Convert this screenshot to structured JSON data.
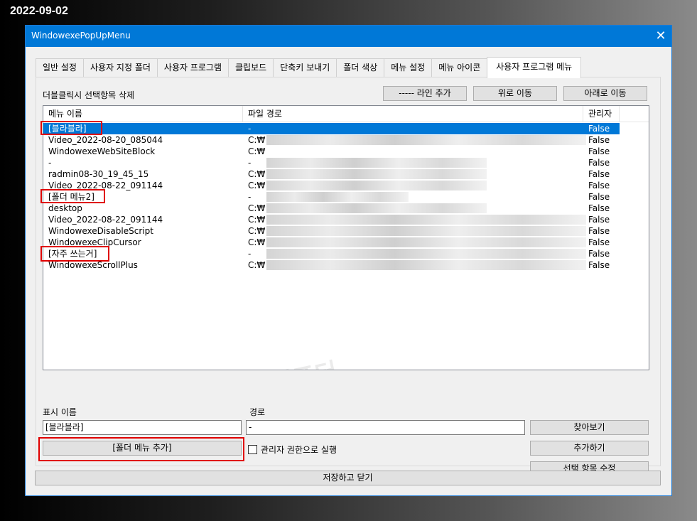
{
  "date_stamp": "2022-09-02",
  "window": {
    "title": "WindowexePopUpMenu",
    "close_glyph": "✕"
  },
  "tabs": [
    {
      "label": "일반 설정"
    },
    {
      "label": "사용자 지정 폴더"
    },
    {
      "label": "사용자 프로그램"
    },
    {
      "label": "클립보드"
    },
    {
      "label": "단축키 보내기"
    },
    {
      "label": "폴더 색상"
    },
    {
      "label": "메뉴 설정"
    },
    {
      "label": "메뉴 아이콘"
    },
    {
      "label": "사용자 프로그램 메뉴",
      "active": true
    }
  ],
  "toolbar": {
    "hint": "더블클릭시 선택항목 삭제",
    "add_line": "----- 라인 추가",
    "move_up": "위로 이동",
    "move_down": "아래로 이동"
  },
  "list": {
    "columns": [
      "메뉴 이름",
      "파일 경로",
      "관리자"
    ],
    "rows": [
      {
        "name": "[블라블라]",
        "path": "-",
        "admin": "False",
        "selected": true
      },
      {
        "name": "Video_2022-08-20_085044",
        "path": "C:₩",
        "admin": "False"
      },
      {
        "name": "WindowexeWebSiteBlock",
        "path": "C:₩",
        "admin": "False"
      },
      {
        "name": "-",
        "path": "-",
        "admin": "False"
      },
      {
        "name": "radmin08-30_19_45_15",
        "path": "C:₩",
        "admin": "False"
      },
      {
        "name": "Video_2022-08-22_091144",
        "path": "C:₩",
        "admin": "False"
      },
      {
        "name": "[폴더 메뉴2]",
        "path": "-",
        "admin": "False"
      },
      {
        "name": "desktop",
        "path": "C:₩",
        "admin": "False"
      },
      {
        "name": "Video_2022-08-22_091144",
        "path": "C:₩",
        "admin": "False"
      },
      {
        "name": "WindowexeDisableScript",
        "path": "C:₩",
        "admin": "False"
      },
      {
        "name": "WindowexeClipCursor",
        "path": "C:₩",
        "admin": "False"
      },
      {
        "name": "[자주 쓰는거]",
        "path": "-",
        "admin": "False"
      },
      {
        "name": "WindowexeScrollPlus",
        "path": "C:₩",
        "admin": "False"
      }
    ]
  },
  "form": {
    "display_name_label": "표시 이름",
    "display_name_value": "[블라블라]",
    "path_label": "경로",
    "path_value": "-",
    "add_folder_menu": "[폴더 메뉴 추가]",
    "run_as_admin": "관리자 권한으로 실행",
    "browse": "찾아보기",
    "add": "추가하기",
    "edit_selected": "선택 항목 수정"
  },
  "save_close": "저장하고 닫기"
}
